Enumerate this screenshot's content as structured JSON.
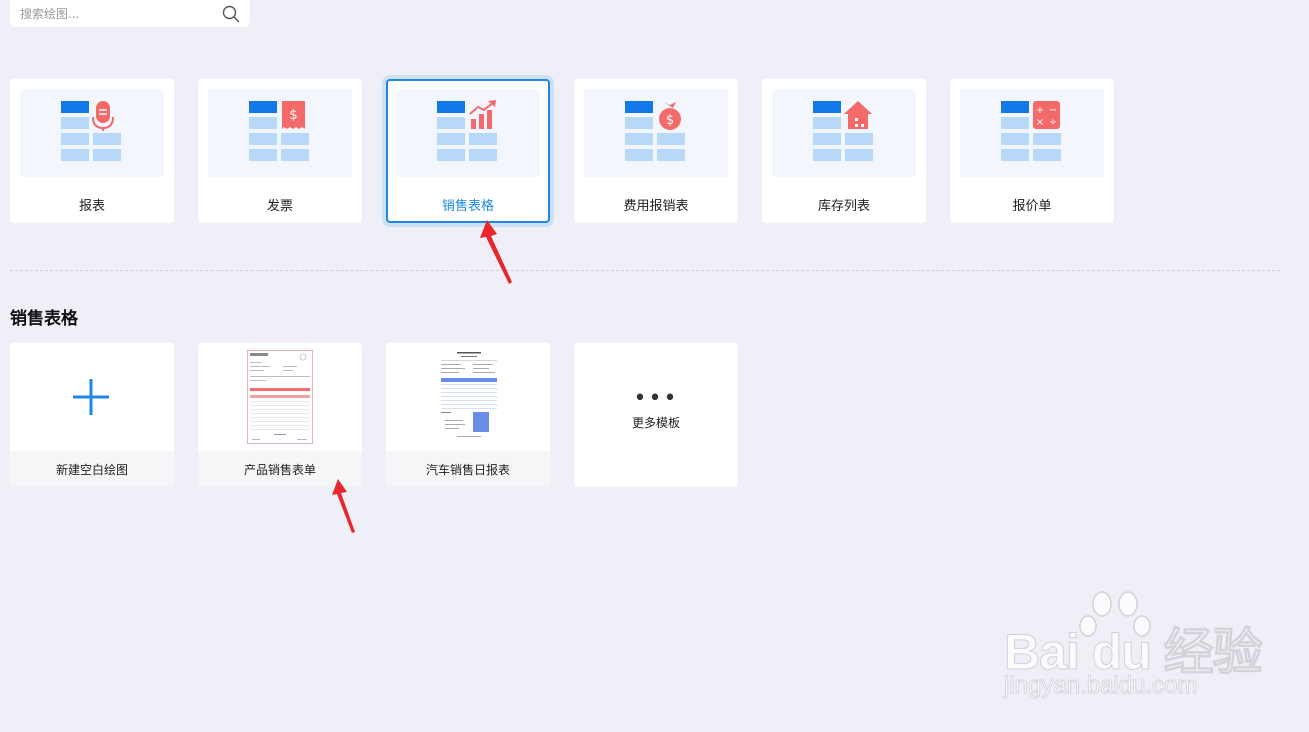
{
  "search": {
    "placeholder": "搜索绘图..."
  },
  "categories": [
    {
      "label": "报表",
      "icon": "microphone-icon"
    },
    {
      "label": "发票",
      "icon": "receipt-icon"
    },
    {
      "label": "销售表格",
      "icon": "bar-chart-icon"
    },
    {
      "label": "费用报销表",
      "icon": "money-bag-icon"
    },
    {
      "label": "库存列表",
      "icon": "house-icon"
    },
    {
      "label": "报价单",
      "icon": "calculator-icon"
    }
  ],
  "active_category": "销售表格",
  "section": {
    "title": "销售表格"
  },
  "templates": [
    {
      "label": "新建空白绘图"
    },
    {
      "label": "产品销售表单"
    },
    {
      "label": "汽车销售日报表"
    },
    {
      "label": "更多模板"
    }
  ],
  "colors": {
    "accent": "#1e88e5",
    "icon_red": "#f46a6a",
    "tile_blue": "#b8d8fa",
    "tile_header": "#1479e8"
  },
  "watermark": {
    "brand": "Bai du 经验",
    "url": "jingyan.baidu.com"
  }
}
